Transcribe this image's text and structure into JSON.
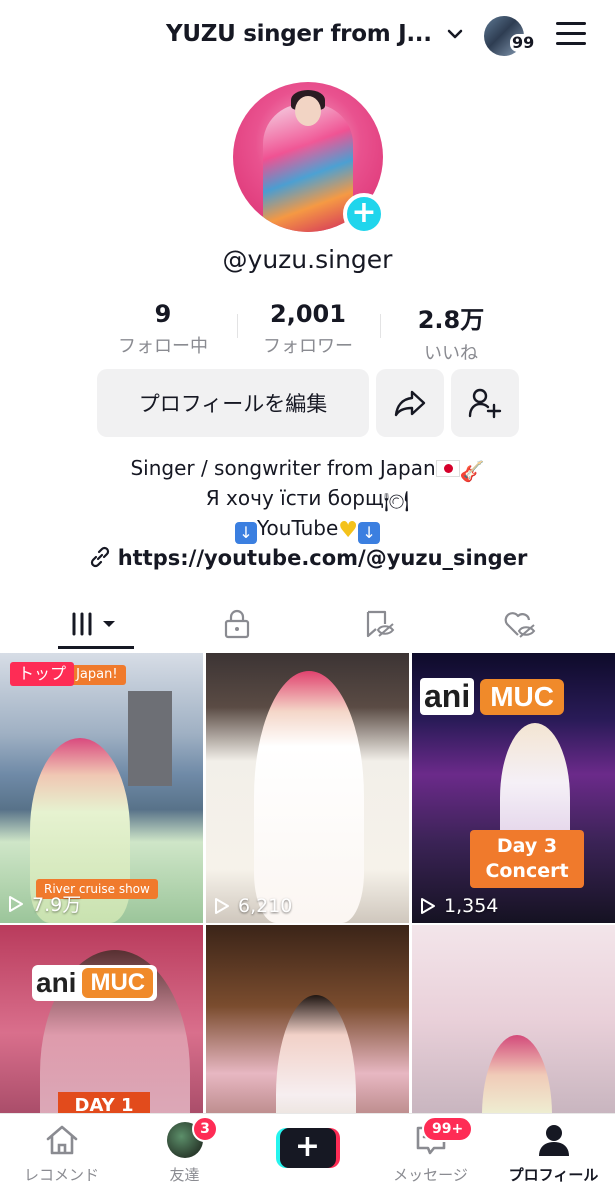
{
  "header": {
    "title": "YUZU singer from J...",
    "notif_count": "99"
  },
  "profile": {
    "username": "@yuzu.singer",
    "stats": [
      {
        "value": "9",
        "label": "フォロー中"
      },
      {
        "value": "2,001",
        "label": "フォロワー"
      },
      {
        "value": "2.8万",
        "label": "いいね"
      }
    ],
    "edit_button": "プロフィールを編集",
    "bio_line1": "Singer / songwriter from Japan",
    "bio_line2": "Я хочу їсти борщ",
    "bio_line3": "YouTube",
    "link": "https://youtube.com/@yuzu_singer"
  },
  "tabs": [
    "videos-grid",
    "private",
    "reposts-hidden",
    "liked-hidden"
  ],
  "videos": [
    {
      "views": "7.9万",
      "pinned_label": "トップ",
      "caption_top": "o in Japan!",
      "caption_bottom": "River cruise show"
    },
    {
      "views": "6,210"
    },
    {
      "views": "1,354",
      "logo_ani": "ani",
      "logo_muc": "MUC",
      "overlay_line1": "Day 3",
      "overlay_line2": "Concert"
    },
    {
      "logo_ani": "ani",
      "logo_muc": "MUC",
      "overlay": "DAY 1"
    },
    {},
    {}
  ],
  "bottom_nav": [
    {
      "label": "レコメンド",
      "icon": "home-icon"
    },
    {
      "label": "友達",
      "icon": "friends-avatar",
      "badge": "3"
    },
    {
      "label": "",
      "icon": "create-icon"
    },
    {
      "label": "メッセージ",
      "icon": "inbox-icon",
      "badge": "99+"
    },
    {
      "label": "プロフィール",
      "icon": "profile-icon",
      "active": true
    }
  ],
  "colors": {
    "accent_red": "#fe2c55",
    "accent_cyan": "#20d5ec",
    "text_primary": "#161823",
    "text_secondary": "#8a8b91",
    "button_bg": "#f1f1f2",
    "caption_orange": "#f07a2c"
  }
}
